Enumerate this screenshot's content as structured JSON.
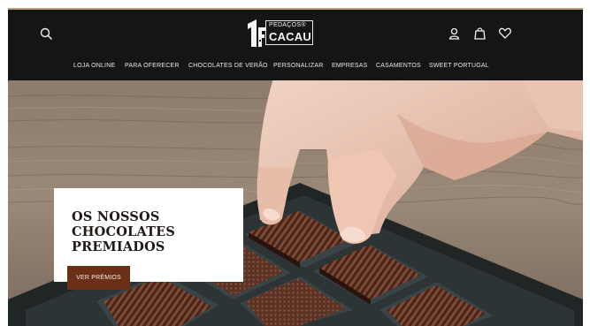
{
  "header": {
    "logo_line1": "PEDAÇOS®",
    "logo_line2": "CACAU",
    "icons": [
      "search-icon",
      "user-icon",
      "bag-icon",
      "heart-icon"
    ],
    "accent_color": "#b9a27a"
  },
  "nav": {
    "items": [
      {
        "label": "LOJA ONLINE"
      },
      {
        "label": "PARA OFERECER"
      },
      {
        "label": "CHOCOLATES DE VERÃO"
      },
      {
        "label": "PERSONALIZAR"
      },
      {
        "label": "EMPRESAS"
      },
      {
        "label": "CASAMENTOS"
      },
      {
        "label": "SWEET PORTUGAL"
      }
    ]
  },
  "hero": {
    "title_lines": [
      "OS NOSSOS",
      "CHOCOLATES",
      "PREMIADOS"
    ],
    "button_label": "VER PRÉMIOS",
    "button_color": "#6b2f16"
  }
}
